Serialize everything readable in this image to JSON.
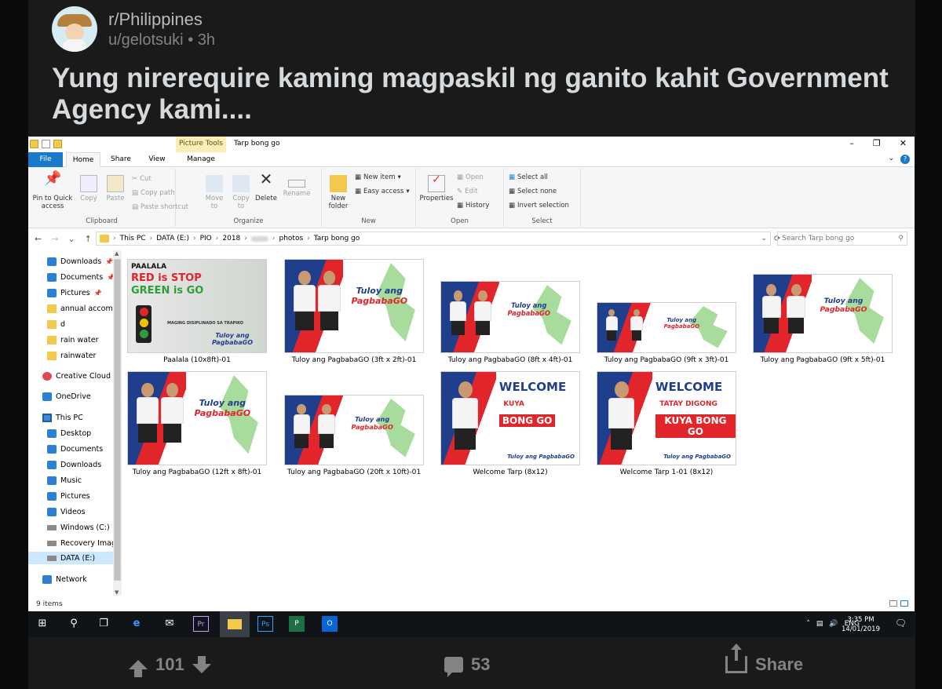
{
  "post": {
    "subreddit": "r/Philippines",
    "user": "u/gelotsuki",
    "time": "3h",
    "title": "Yung nirerequire kaming magpaskil ng ganito kahit Government Agency kami....",
    "upvotes": "101",
    "comments": "53",
    "share_label": "Share"
  },
  "explorer": {
    "window_title": "Tarp bong go",
    "context_tab": "Picture Tools",
    "tabs": [
      "File",
      "Home",
      "Share",
      "View",
      "Manage"
    ],
    "ribbon": {
      "clipboard": {
        "pin": "Pin to Quick access",
        "copy": "Copy",
        "paste": "Paste",
        "cut": "Cut",
        "copy_path": "Copy path",
        "paste_shortcut": "Paste shortcut",
        "label": "Clipboard"
      },
      "organize": {
        "move": "Move to",
        "copy": "Copy to",
        "delete": "Delete",
        "rename": "Rename",
        "label": "Organize"
      },
      "new": {
        "folder": "New folder",
        "item": "New item",
        "easy": "Easy access",
        "label": "New"
      },
      "open": {
        "properties": "Properties",
        "open": "Open",
        "edit": "Edit",
        "history": "History",
        "label": "Open"
      },
      "select": {
        "all": "Select all",
        "none": "Select none",
        "invert": "Invert selection",
        "label": "Select"
      }
    },
    "breadcrumb": [
      "This PC",
      "DATA (E:)",
      "PIO",
      "2018",
      "photos",
      "Tarp bong go"
    ],
    "search_placeholder": "Search Tarp bong go",
    "nav": [
      {
        "label": "Downloads",
        "icon": "download-icon",
        "pinned": true
      },
      {
        "label": "Documents",
        "icon": "documents-icon",
        "pinned": true
      },
      {
        "label": "Pictures",
        "icon": "pictures-icon",
        "pinned": true
      },
      {
        "label": "annual accomp",
        "icon": "folder-icon",
        "pinned": false
      },
      {
        "label": "d",
        "icon": "folder-icon",
        "pinned": false
      },
      {
        "label": "rain water",
        "icon": "folder-icon",
        "pinned": false
      },
      {
        "label": "rainwater",
        "icon": "folder-icon",
        "pinned": false
      },
      {
        "label": "Creative Cloud F",
        "icon": "creative-cloud-icon",
        "pinned": false
      },
      {
        "label": "OneDrive",
        "icon": "onedrive-icon",
        "pinned": false
      },
      {
        "label": "This PC",
        "icon": "this-pc-icon",
        "pinned": false
      },
      {
        "label": "Desktop",
        "icon": "desktop-icon",
        "pinned": false
      },
      {
        "label": "Documents",
        "icon": "documents-icon",
        "pinned": false
      },
      {
        "label": "Downloads",
        "icon": "download-icon",
        "pinned": false
      },
      {
        "label": "Music",
        "icon": "music-icon",
        "pinned": false
      },
      {
        "label": "Pictures",
        "icon": "pictures-icon",
        "pinned": false
      },
      {
        "label": "Videos",
        "icon": "videos-icon",
        "pinned": false
      },
      {
        "label": "Windows (C:)",
        "icon": "drive-icon",
        "pinned": false
      },
      {
        "label": "Recovery Imag",
        "icon": "drive-icon",
        "pinned": false
      },
      {
        "label": "DATA (E:)",
        "icon": "drive-icon",
        "pinned": false
      },
      {
        "label": "Network",
        "icon": "network-icon",
        "pinned": false
      }
    ],
    "pin_glyph": "📌",
    "files": [
      {
        "name": "Paalala (10x8ft)-01",
        "kind": "stop",
        "t1": "PAALALA",
        "t2": "RED is STOP",
        "t3": "GREEN is GO",
        "t4": "MAGING DISIPLINADO SA TRAPIKO",
        "t5": "Tuloy ang PagbabaGO"
      },
      {
        "name": "Tuloy ang PagbabaGO (3ft x 2ft)-01",
        "kind": "tuloy",
        "t1": "Tuloy ang",
        "t2": "PagbabaGO"
      },
      {
        "name": "Tuloy ang PagbabaGO (8ft x 4ft)-01",
        "kind": "tuloy",
        "t1": "Tuloy ang",
        "t2": "PagbabaGO"
      },
      {
        "name": "Tuloy ang PagbabaGO (9ft x 3ft)-01",
        "kind": "tuloy",
        "t1": "Tuloy ang",
        "t2": "PagbabaGO"
      },
      {
        "name": "Tuloy ang PagbabaGO (9ft x 5ft)-01",
        "kind": "tuloy",
        "t1": "Tuloy ang",
        "t2": "PagbabaGO"
      },
      {
        "name": "Tuloy ang PagbabaGO (12ft x 8ft)-01",
        "kind": "tuloy",
        "t1": "Tuloy ang",
        "t2": "PagbabaGO"
      },
      {
        "name": "Tuloy ang PagbabaGO (20ft x 10ft)-01",
        "kind": "tuloy",
        "t1": "Tuloy ang",
        "t2": "PagbabaGO"
      },
      {
        "name": "Welcome Tarp (8x12)",
        "kind": "welcome",
        "t1": "WELCOME",
        "t2": "KUYA",
        "t3": "BONG GO",
        "t4": "Tuloy ang PagbabaGO"
      },
      {
        "name": "Welcome Tarp 1-01 (8x12)",
        "kind": "welcome",
        "t1": "WELCOME",
        "t2": "TATAY DIGONG",
        "t3": "KUYA BONG GO",
        "t4": "Tuloy ang PagbabaGO"
      }
    ],
    "status": "9 items"
  },
  "taskbar": {
    "lang": "ENG",
    "time": "3:35 PM",
    "date": "14/01/2019",
    "apps": [
      "Ps",
      "Pr"
    ]
  }
}
